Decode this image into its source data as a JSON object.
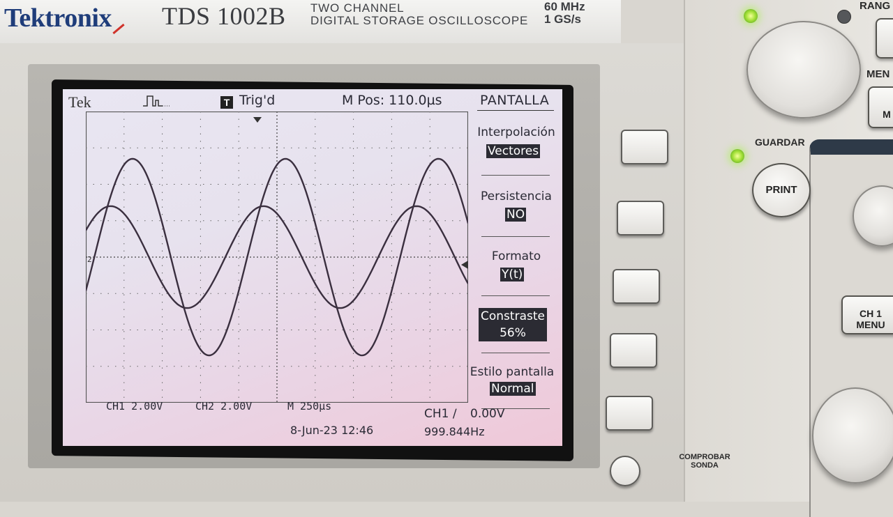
{
  "device": {
    "brand": "Tektronix",
    "model": "TDS 1002B",
    "model_line1": "TWO CHANNEL",
    "model_line2": "DIGITAL STORAGE OSCILLOSCOPE",
    "spec_bandwidth": "60 MHz",
    "spec_samplerate": "1 GS/s"
  },
  "screen": {
    "logo": "Tek",
    "acq_icon": "pulse-acquire-icon",
    "trig_icon_letter": "T",
    "trig_status": "Trig'd",
    "m_pos": "M Pos: 110.0µs",
    "menu_title": "PANTALLA",
    "channel_marker": "2",
    "menu": [
      {
        "label": "Interpolación",
        "value": "Vectores"
      },
      {
        "label": "Persistencia",
        "value": "NO"
      },
      {
        "label": "Formato",
        "value": "Y(t)"
      },
      {
        "label": "Constraste",
        "value": "56%"
      },
      {
        "label": "Estilo pantalla",
        "value": "Normal"
      }
    ],
    "status": {
      "ch1": "CH1  2.00V",
      "ch2": "CH2  2.00V",
      "timebase": "M 250µs",
      "trigger": "CH1 ∕",
      "trigger_level": "0.00V",
      "datetime": "8-Jun-23 12:46",
      "frequency": "999.844Hz"
    },
    "traces": {
      "ch1": {
        "amplitude_div": 2.7,
        "offset_div": 0,
        "cycles_visible": 2.5
      },
      "ch2": {
        "amplitude_div": 1.4,
        "offset_div": 0,
        "cycles_visible": 2.5
      }
    }
  },
  "panel": {
    "range_label": "RANG",
    "menu_label": "MEN",
    "save_label": "GUARDAR",
    "print_label": "PRINT",
    "ch1_menu_label_1": "CH 1",
    "ch1_menu_label_2": "MENU",
    "probe_label_1": "COMPROBAR",
    "probe_label_2": "SONDA",
    "small_btn_label": "M"
  },
  "colors": {
    "brand_blue": "#1f3d7a",
    "trace": "#3a2f3f",
    "led_green": "#a6e23a"
  }
}
